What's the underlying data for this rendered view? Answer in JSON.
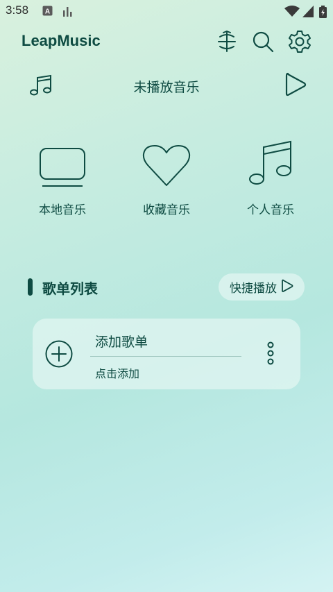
{
  "status_bar": {
    "time": "3:58"
  },
  "header": {
    "app_title": "LeapMusic",
    "icons": [
      "scroll-icon",
      "search-icon",
      "settings-icon"
    ]
  },
  "now_playing": {
    "title": "未播放音乐"
  },
  "categories": [
    {
      "label": "本地音乐",
      "icon": "monitor-icon"
    },
    {
      "label": "收藏音乐",
      "icon": "heart-icon"
    },
    {
      "label": "个人音乐",
      "icon": "music-note-icon"
    }
  ],
  "playlist_section": {
    "title": "歌单列表",
    "quick_play_label": "快捷播放"
  },
  "playlist_card": {
    "title": "添加歌单",
    "subtitle": "点击添加"
  },
  "colors": {
    "primary": "#0e4b42",
    "card_bg": "#e1f6f1"
  }
}
